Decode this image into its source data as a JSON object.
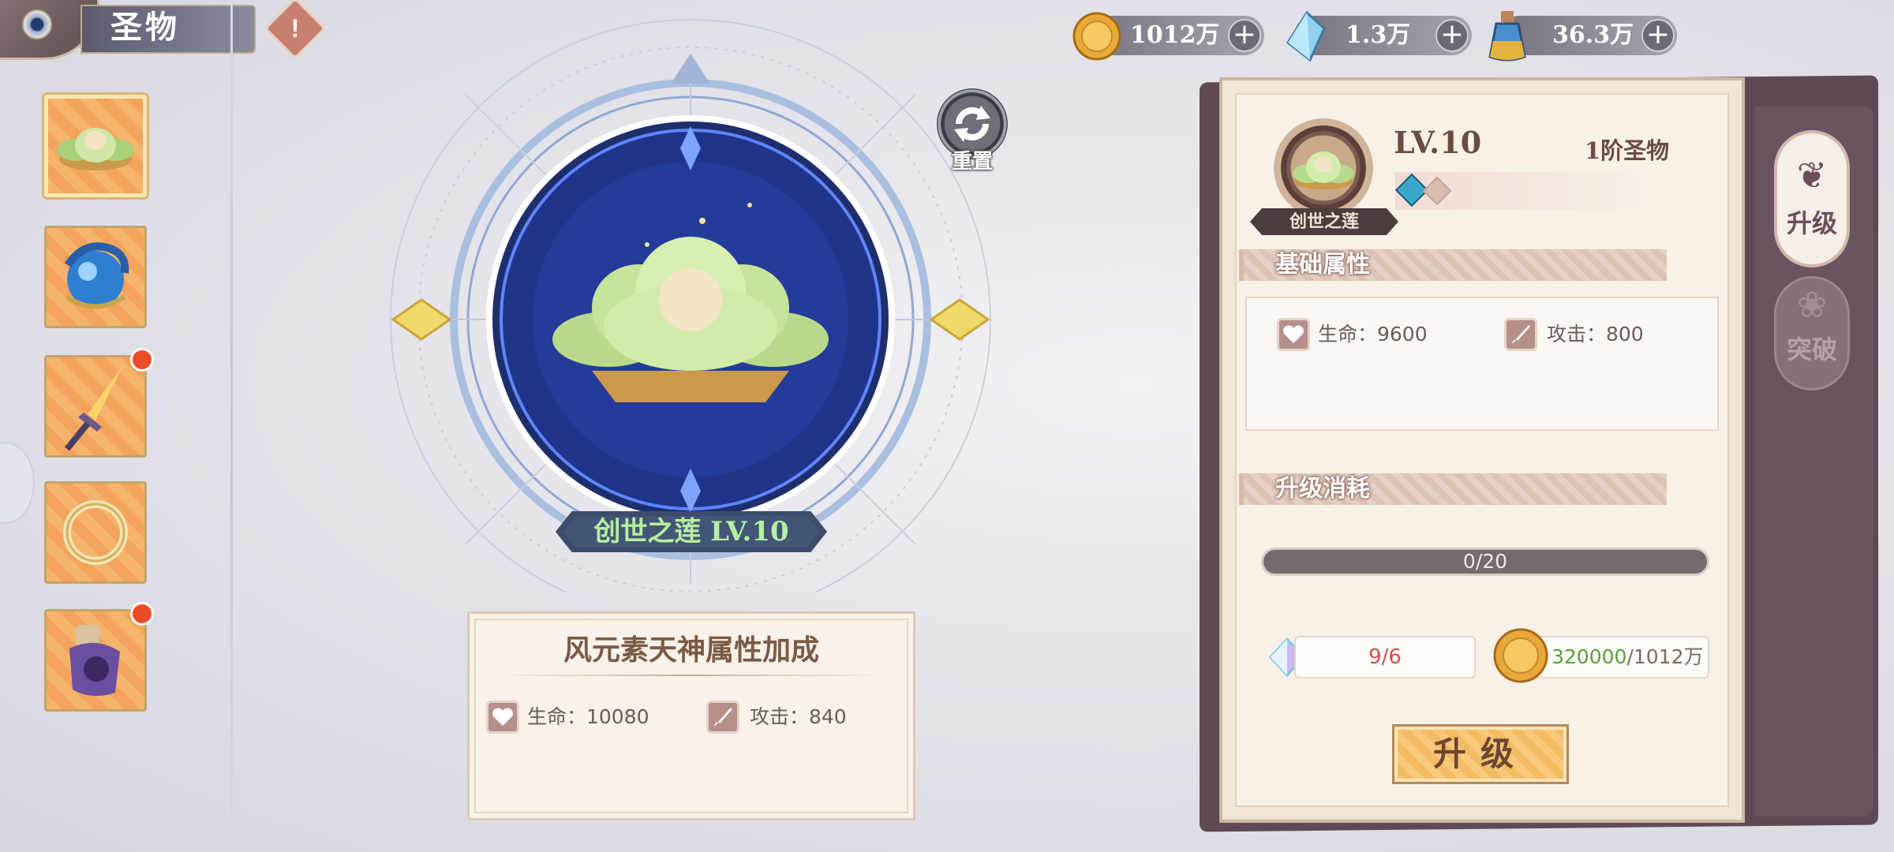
{
  "header": {
    "title": "圣物"
  },
  "currencies": [
    {
      "name": "gold",
      "value": "1012万",
      "color": "#e9a93a"
    },
    {
      "name": "crystal",
      "value": "1.3万",
      "color": "#7fc3e6"
    },
    {
      "name": "potion",
      "value": "36.3万",
      "color": "#e3b23f"
    }
  ],
  "relic_list": [
    {
      "name": "lotus",
      "selected": true,
      "has_notice": false
    },
    {
      "name": "dragon-orb",
      "selected": false,
      "has_notice": false
    },
    {
      "name": "sword",
      "selected": false,
      "has_notice": true
    },
    {
      "name": "ring",
      "selected": false,
      "has_notice": false
    },
    {
      "name": "purple-scroll",
      "selected": false,
      "has_notice": true
    }
  ],
  "center": {
    "reset_label": "重置",
    "relic_name": "创世之莲 LV.10",
    "bonus_card": {
      "title": "风元素天神属性加成",
      "hp_label": "生命：10080",
      "atk_label": "攻击：840"
    }
  },
  "panel": {
    "portrait_name": "创世之莲",
    "level": "LV.10",
    "tier": "1阶圣物",
    "base_title": "基础属性",
    "base_hp": "生命：9600",
    "base_atk": "攻击：800",
    "cost_title": "升级消耗",
    "progress_text": "0/20",
    "progress_fraction": 0,
    "cost_gem": "9/6",
    "cost_coin_have": "320000",
    "cost_coin_need": "/1012万",
    "upgrade_button": "升级"
  },
  "tabs": {
    "upgrade": "升级",
    "breakthrough": "突破"
  }
}
